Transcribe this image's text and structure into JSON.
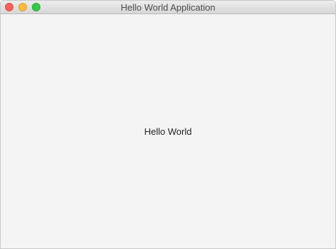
{
  "window": {
    "title": "Hello World Application"
  },
  "main": {
    "label": "Hello World"
  },
  "colors": {
    "close": "#fc605b",
    "minimize": "#fdbc40",
    "zoom": "#34c84a",
    "background": "#f4f4f4"
  }
}
